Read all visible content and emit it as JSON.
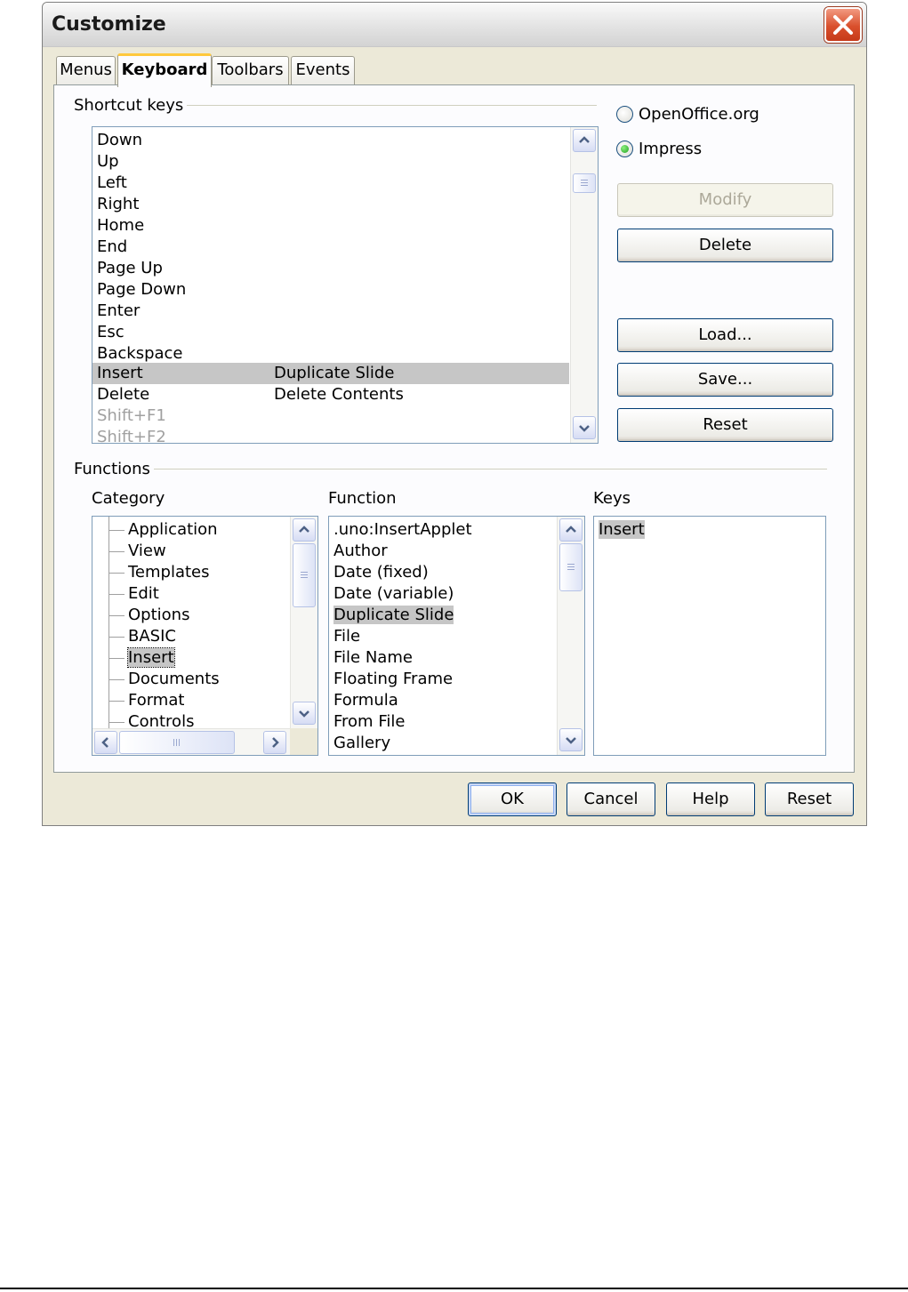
{
  "dialog": {
    "title": "Customize"
  },
  "tabs": [
    {
      "label": "Menus"
    },
    {
      "label": "Keyboard"
    },
    {
      "label": "Toolbars"
    },
    {
      "label": "Events"
    }
  ],
  "shortcut_keys": {
    "label": "Shortcut keys",
    "rows": [
      {
        "key": "Down",
        "function": ""
      },
      {
        "key": "Up",
        "function": ""
      },
      {
        "key": "Left",
        "function": ""
      },
      {
        "key": "Right",
        "function": ""
      },
      {
        "key": "Home",
        "function": ""
      },
      {
        "key": "End",
        "function": ""
      },
      {
        "key": "Page Up",
        "function": ""
      },
      {
        "key": "Page Down",
        "function": ""
      },
      {
        "key": "Enter",
        "function": ""
      },
      {
        "key": "Esc",
        "function": ""
      },
      {
        "key": "Backspace",
        "function": ""
      },
      {
        "key": "Insert",
        "function": "Duplicate Slide"
      },
      {
        "key": "Delete",
        "function": "Delete Contents"
      },
      {
        "key": "Shift+F1",
        "function": ""
      },
      {
        "key": "Shift+F2",
        "function": ""
      }
    ]
  },
  "scope": {
    "openoffice_label": "OpenOffice.org",
    "impress_label": "Impress",
    "selected": "Impress"
  },
  "buttons": {
    "modify": "Modify",
    "delete": "Delete",
    "load": "Load...",
    "save": "Save...",
    "reset": "Reset"
  },
  "functions": {
    "label": "Functions",
    "category_label": "Category",
    "function_label": "Function",
    "keys_label": "Keys",
    "categories": [
      "Application",
      "View",
      "Templates",
      "Edit",
      "Options",
      "BASIC",
      "Insert",
      "Documents",
      "Format",
      "Controls"
    ],
    "functions": [
      ".uno:InsertApplet",
      "Author",
      "Date (fixed)",
      "Date (variable)",
      "Duplicate Slide",
      "File",
      "File Name",
      "Floating Frame",
      "Formula",
      "From File",
      "Gallery"
    ],
    "keys": [
      "Insert"
    ]
  },
  "footer": {
    "ok": "OK",
    "cancel": "Cancel",
    "help": "Help",
    "reset": "Reset"
  }
}
